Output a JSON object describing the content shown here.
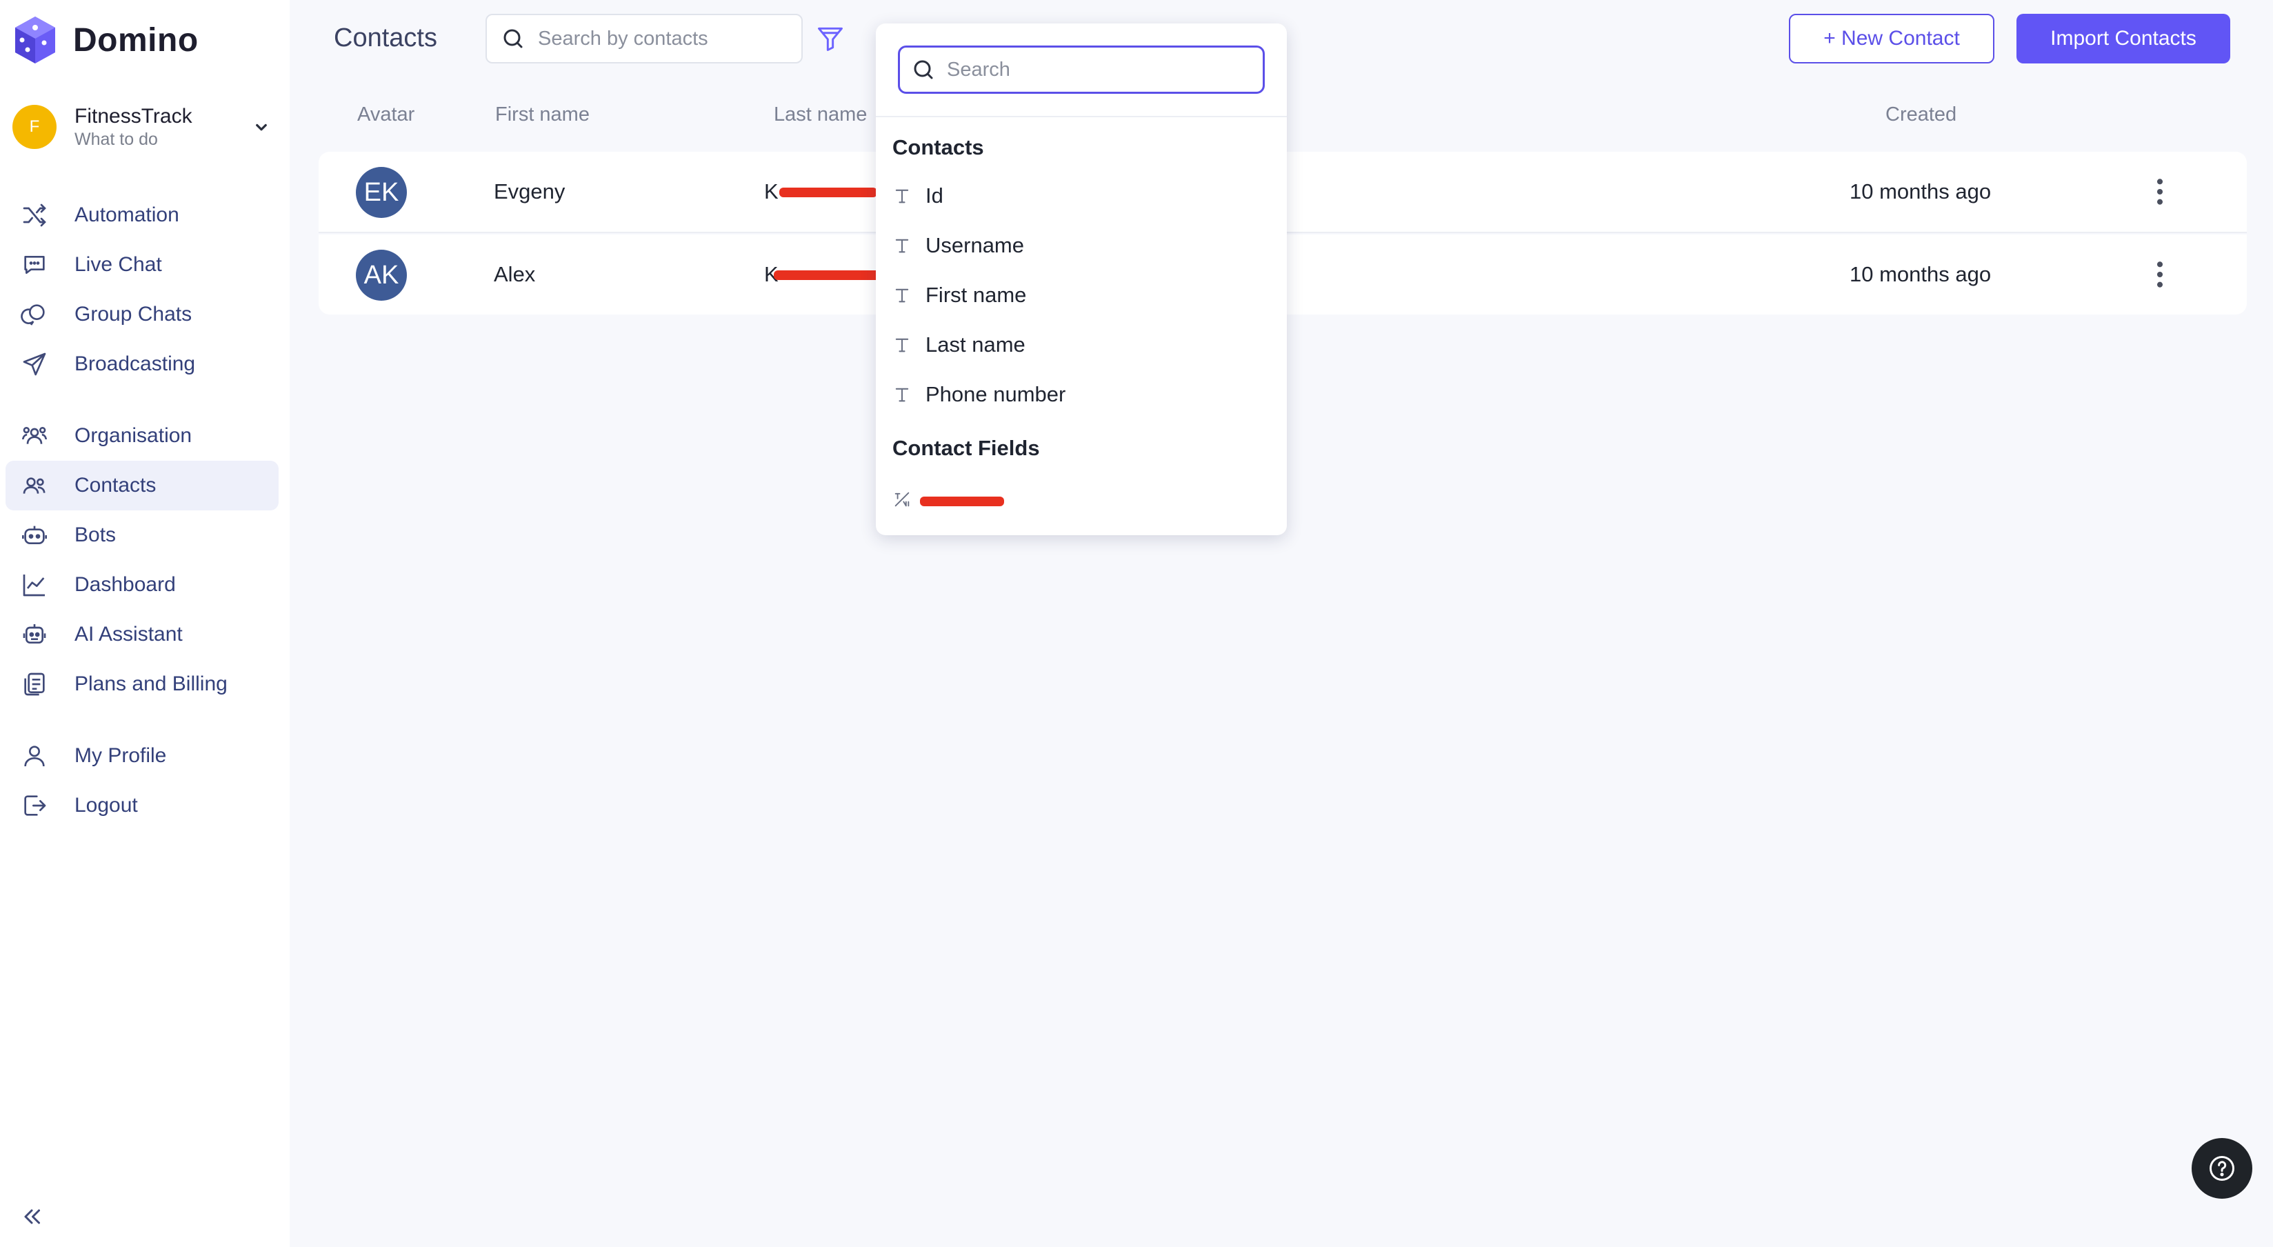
{
  "brand": {
    "name": "Domino"
  },
  "workspace": {
    "initial": "F",
    "name": "FitnessTrack",
    "subtitle": "What to do"
  },
  "nav": {
    "automation": "Automation",
    "live_chat": "Live Chat",
    "group_chats": "Group Chats",
    "broadcasting": "Broadcasting",
    "organisation": "Organisation",
    "contacts": "Contacts",
    "bots": "Bots",
    "dashboard": "Dashboard",
    "ai_assistant": "AI Assistant",
    "plans_billing": "Plans and Billing",
    "my_profile": "My Profile",
    "logout": "Logout"
  },
  "header": {
    "title": "Contacts",
    "search_placeholder": "Search by contacts",
    "new_contact": "+ New Contact",
    "import_contacts": "Import Contacts"
  },
  "table": {
    "columns": {
      "avatar": "Avatar",
      "first_name": "First name",
      "last_name": "Last name",
      "created": "Created"
    },
    "rows": [
      {
        "initials": "EK",
        "first_name": "Evgeny",
        "last_name_prefix": "K",
        "created": "10 months ago"
      },
      {
        "initials": "AK",
        "first_name": "Alex",
        "last_name_prefix": "K",
        "created": "10 months ago"
      }
    ]
  },
  "dropdown": {
    "search_placeholder": "Search",
    "sections": {
      "contacts": "Contacts",
      "contact_fields": "Contact Fields"
    },
    "items": {
      "id": "Id",
      "username": "Username",
      "first_name": "First name",
      "last_name": "Last name",
      "phone": "Phone number"
    }
  },
  "colors": {
    "accent": "#6155f5",
    "nav_text": "#33407a",
    "avatar_bg": "#3e5b96",
    "workspace_avatar": "#f5b800",
    "redaction": "#e8301f"
  }
}
